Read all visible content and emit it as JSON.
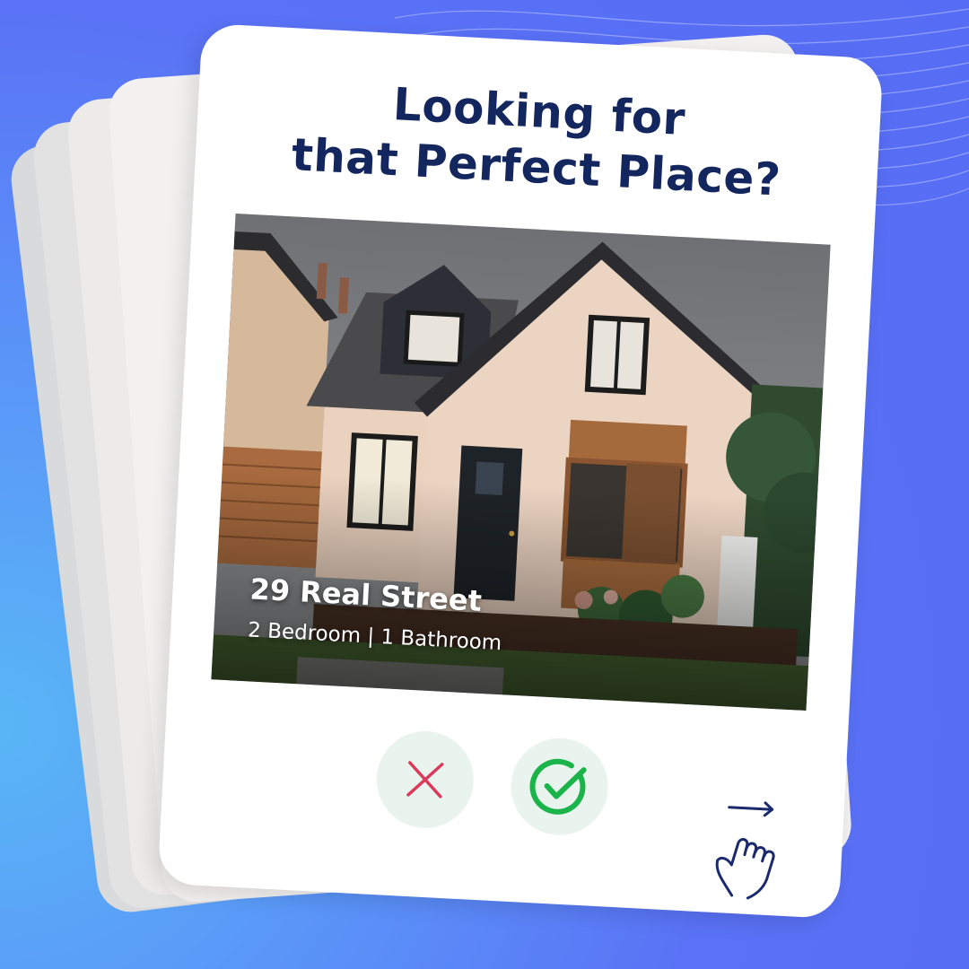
{
  "headline": {
    "line1": "Looking for",
    "line2": "that Perfect Place?"
  },
  "listing": {
    "title": "29 Real Street",
    "details": "2 Bedroom | 1 Bathroom",
    "photo_subject": "house-photo"
  },
  "actions": {
    "reject_icon": "close-icon",
    "accept_icon": "check-circle-icon"
  },
  "swipe_hint": {
    "icon": "swipe-right-hand-icon"
  },
  "colors": {
    "background": "#566cf4",
    "headline": "#14265e",
    "reject": "#dc3a5b",
    "accept": "#1ab44a",
    "button_bg": "#e9f4ef",
    "hand": "#1a2a6c"
  }
}
